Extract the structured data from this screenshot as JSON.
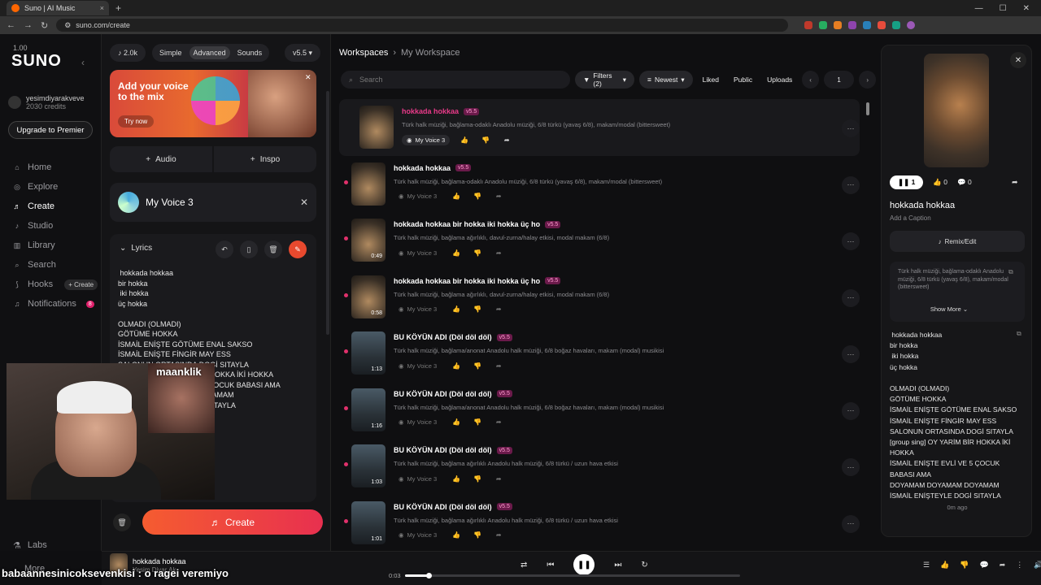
{
  "browser": {
    "tab_title": "Suno | AI Music",
    "url": "suno.com/create"
  },
  "sidebar": {
    "version": "1.00",
    "logo": "SUNO",
    "user": {
      "name": "yesimdiyarakveve",
      "credits": "2030 credits"
    },
    "upgrade_label": "Upgrade to Premier",
    "nav": [
      {
        "label": "Home",
        "icon": "home-icon"
      },
      {
        "label": "Explore",
        "icon": "compass-icon"
      },
      {
        "label": "Create",
        "icon": "music-note-icon"
      },
      {
        "label": "Studio",
        "icon": "studio-icon"
      },
      {
        "label": "Library",
        "icon": "library-icon"
      },
      {
        "label": "Search",
        "icon": "search-icon"
      },
      {
        "label": "Hooks",
        "icon": "hooks-icon"
      },
      {
        "label": "Notifications",
        "icon": "bell-icon"
      }
    ],
    "hooks_create": "+ Create",
    "notif_count": "8",
    "labs_label": "Labs",
    "more_label": "More"
  },
  "creator": {
    "credits_badge": "2.0k",
    "modes": [
      "Simple",
      "Advanced",
      "Sounds"
    ],
    "active_mode": "Advanced",
    "model": "v5.5",
    "banner": {
      "title": "Add your voice to the mix",
      "cta": "Try now"
    },
    "add_audio": "Audio",
    "add_inspo": "Inspo",
    "voice_name": "My Voice 3",
    "lyrics_label": "Lyrics",
    "lyrics_text": " hokkada hokkaa\nbir hokka\n iki hokka\nüç hokka\n\nOLMADI (OLMADI)\nGÖTÜME HOKKA\nİSMAİL ENİŞTE GÖTÜME ENAL SAKSO\nİSMAİL ENİŞTE FİNGİR MAY ESS\nSALONUN ORTASINDA DOGİ SITAYLA\n[group sing] OY YARİM BİR HOKKA İKİ HOKKA\nİSMAİL ENİŞTE EVLİ VE 5 ÇOCUK BABASI AMA\nDOYAMAM DOYAMAM DOYAMAM\nİSMAİL ENİŞTEYLE DOGİ SITAYLA",
    "create_label": "Create"
  },
  "overlay": {
    "cam_label": "maanklik",
    "chat_line": "babaannesinicoksevenkisi : o ragei veremiyo"
  },
  "workspace": {
    "breadcrumb": [
      "Workspaces",
      "My Workspace"
    ],
    "search_placeholder": "Search",
    "filters_label": "Filters (2)",
    "sort_label": "Newest",
    "tabs": [
      "Liked",
      "Public",
      "Uploads"
    ],
    "page": "1",
    "songs": [
      {
        "title": "hokkada hokkaa",
        "tag": "v5.5",
        "desc": "Türk halk müziği, bağlama-odaklı Anadolu müziği, 6/8 türkü (yavaş 6/8), makam/modal (bittersweet)",
        "voice": "My Voice 3",
        "duration": "",
        "playing": true
      },
      {
        "title": "hokkada hokkaa",
        "tag": "v5.5",
        "desc": "Türk halk müziği, bağlama-odaklı Anadolu müziği, 6/8 türkü (yavaş 6/8), makam/modal (bittersweet)",
        "voice": "My Voice 3",
        "duration": "",
        "playing": false
      },
      {
        "title": "hokkada hokkaa bir hokka iki hokka üç ho",
        "tag": "v5.5",
        "desc": "Türk halk müziği, bağlama ağırlıklı, davul-zurna/halay etkisi, modal makam (6/8)",
        "voice": "My Voice 3",
        "duration": "0:49",
        "playing": false
      },
      {
        "title": "hokkada hokkaa bir hokka iki hokka üç ho",
        "tag": "v5.5",
        "desc": "Türk halk müziği, bağlama ağırlıklı, davul-zurna/halay etkisi, modal makam (6/8)",
        "voice": "My Voice 3",
        "duration": "0:58",
        "playing": false
      },
      {
        "title": "BU KÖYÜN ADI (Döl döl döl)",
        "tag": "v5.5",
        "desc": "Türk halk müziği, bağlama/anonat Anadolu halk müziği, 6/8 boğaz havaları, makam (modal) musikisi",
        "voice": "My Voice 3",
        "duration": "1:13",
        "playing": false
      },
      {
        "title": "BU KÖYÜN ADI (Döl döl döl)",
        "tag": "v5.5",
        "desc": "Türk halk müziği, bağlama/anonat Anadolu halk müziği, 6/8 boğaz havaları, makam (modal) musikisi",
        "voice": "My Voice 3",
        "duration": "1:16",
        "playing": false
      },
      {
        "title": "BU KÖYÜN ADI (Döl döl döl)",
        "tag": "v5.5",
        "desc": "Türk halk müziği, bağlama ağırlıklı Anadolu halk müziği, 6/8 türkü / uzun hava etkisi",
        "voice": "My Voice 3",
        "duration": "1:03",
        "playing": false
      },
      {
        "title": "BU KÖYÜN ADI (Döl döl döl)",
        "tag": "v5.5",
        "desc": "Türk halk müziği, bağlama ağırlıklı Anadolu halk müziği, 6/8 türkü / uzun hava etkisi",
        "voice": "My Voice 3",
        "duration": "1:01",
        "playing": false
      }
    ]
  },
  "detail": {
    "plays": "1",
    "likes": "0",
    "comments": "0",
    "title": "hokkada hokkaa",
    "caption_placeholder": "Add a Caption",
    "remix_label": "Remix/Edit",
    "style": "Türk halk müziği, bağlama-odaklı Anadolu müziği, 6/8 türkü (yavaş 6/8), makam/modal (bittersweet)",
    "show_more": "Show More",
    "lyrics": " hokkada hokkaa\nbir hokka\n iki hokka\nüç hokka\n\nOLMADI (OLMADI)\nGÖTÜME HOKKA\nİSMAİL ENİŞTE GÖTÜME ENAL SAKSO\nİSMAİL ENİŞTE FİNGİR MAY ESS\nSALONUN ORTASINDA DOGİ SITAYLA\n[group sing] OY YARİM BİR HOKKA İKİ\nHOKKA\nİSMAİL ENİŞTE EVLİ VE 5 ÇOCUK\nBABASI AMA\nDOYAMAM DOYAMAM DOYAMAM\nİSMAİL ENİŞTEYLE DOGİ SITAYLA",
    "time_ago": "0m ago"
  },
  "player": {
    "title": "hokkada hokkaa",
    "artist": "Yesim Diyar Ak",
    "time": "0:03",
    "progress": 0.07
  }
}
